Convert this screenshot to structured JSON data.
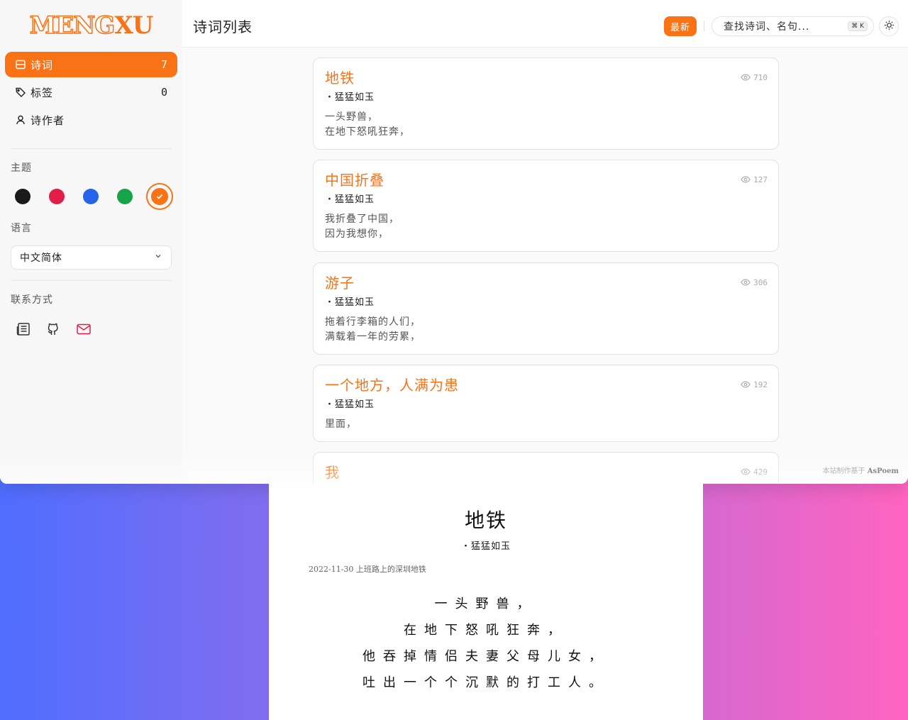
{
  "logo": {
    "part1": "MENG",
    "part2": "XU"
  },
  "sidebar": {
    "items": [
      {
        "label": "诗词",
        "count": "7"
      },
      {
        "label": "标签",
        "count": "0"
      },
      {
        "label": "诗作者",
        "count": ""
      }
    ],
    "theme_title": "主题",
    "theme_colors": [
      "#1a1a1a",
      "#e11d48",
      "#2563eb",
      "#16a34a",
      "#f97316"
    ],
    "selected_theme": "#f97316",
    "language_title": "语言",
    "language_value": "中文简体",
    "contact_title": "联系方式"
  },
  "header": {
    "title": "诗词列表",
    "latest_label": "最新",
    "search_placeholder": "查找诗词、名句...",
    "search_shortcut": "⌘ K"
  },
  "poems": [
    {
      "title": "地铁",
      "author": "・猛猛如玉",
      "views": "710",
      "lines": [
        "一头野兽，",
        "在地下怒吼狂奔，"
      ]
    },
    {
      "title": "中国折叠",
      "author": "・猛猛如玉",
      "views": "127",
      "lines": [
        "我折叠了中国，",
        "因为我想你，"
      ]
    },
    {
      "title": "游子",
      "author": "・猛猛如玉",
      "views": "306",
      "lines": [
        "拖着行李箱的人们，",
        "满载着一年的劳累，"
      ]
    },
    {
      "title": "一个地方，人满为患",
      "author": "・猛猛如玉",
      "views": "192",
      "lines": [
        "里面，"
      ]
    },
    {
      "title": "我",
      "author": "",
      "views": "429",
      "lines": []
    }
  ],
  "footer": {
    "prefix": "本站制作基于",
    "brand": "AsPoem"
  },
  "detail": {
    "title": "地铁",
    "author": "・猛猛如玉",
    "note": "2022-11-30 上班路上的深圳地铁",
    "lines": [
      "一头野兽，",
      "在地下怒吼狂奔，",
      "他吞掉情侣夫妻父母儿女，",
      "吐出一个个沉默的打工人。"
    ]
  }
}
